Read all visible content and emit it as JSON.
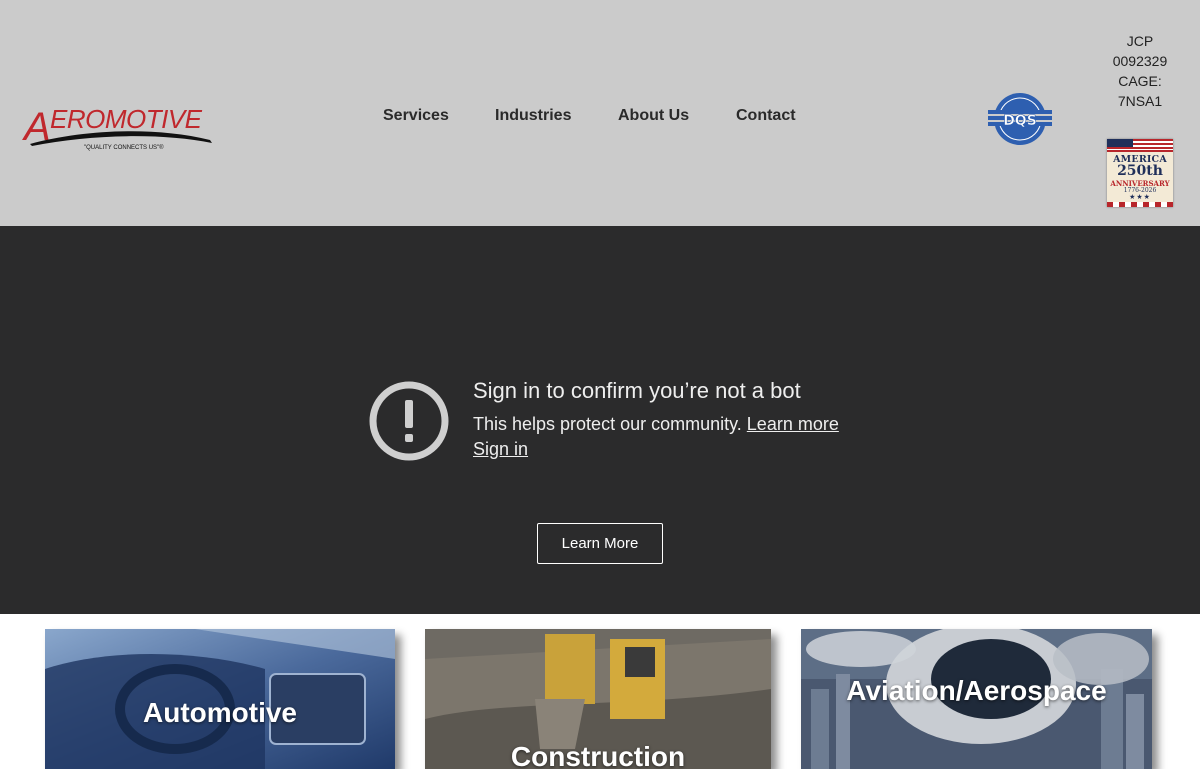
{
  "header": {
    "logo_text": "AEROMOTIVE",
    "logo_tagline": "\"QUALITY CONNECTS US\"®",
    "nav": [
      {
        "label": "Services"
      },
      {
        "label": "Industries"
      },
      {
        "label": "About Us"
      },
      {
        "label": "Contact"
      }
    ],
    "registration": [
      "JCP",
      "0092329",
      "CAGE:",
      "7NSA1"
    ],
    "anniversary_badge": {
      "line1": "AMERICA",
      "line2": "250th",
      "line3": "ANNIVERSARY",
      "line4": "1776-2026",
      "line5": "★★★"
    }
  },
  "bot_check": {
    "title": "Sign in to confirm you’re not a bot",
    "description": "This helps protect our community.",
    "learn_more_link": "Learn more",
    "sign_in_link": "Sign in",
    "icon": "alert-circle-icon"
  },
  "hero_button": "Learn More",
  "industries": [
    {
      "label": "Automotive"
    },
    {
      "label": "Construction"
    },
    {
      "label": "Aviation/Aerospace"
    }
  ],
  "colors": {
    "header_bg": "#cbcbcb",
    "hero_bg": "#2b2b2c",
    "logo_red": "#c0282d"
  }
}
